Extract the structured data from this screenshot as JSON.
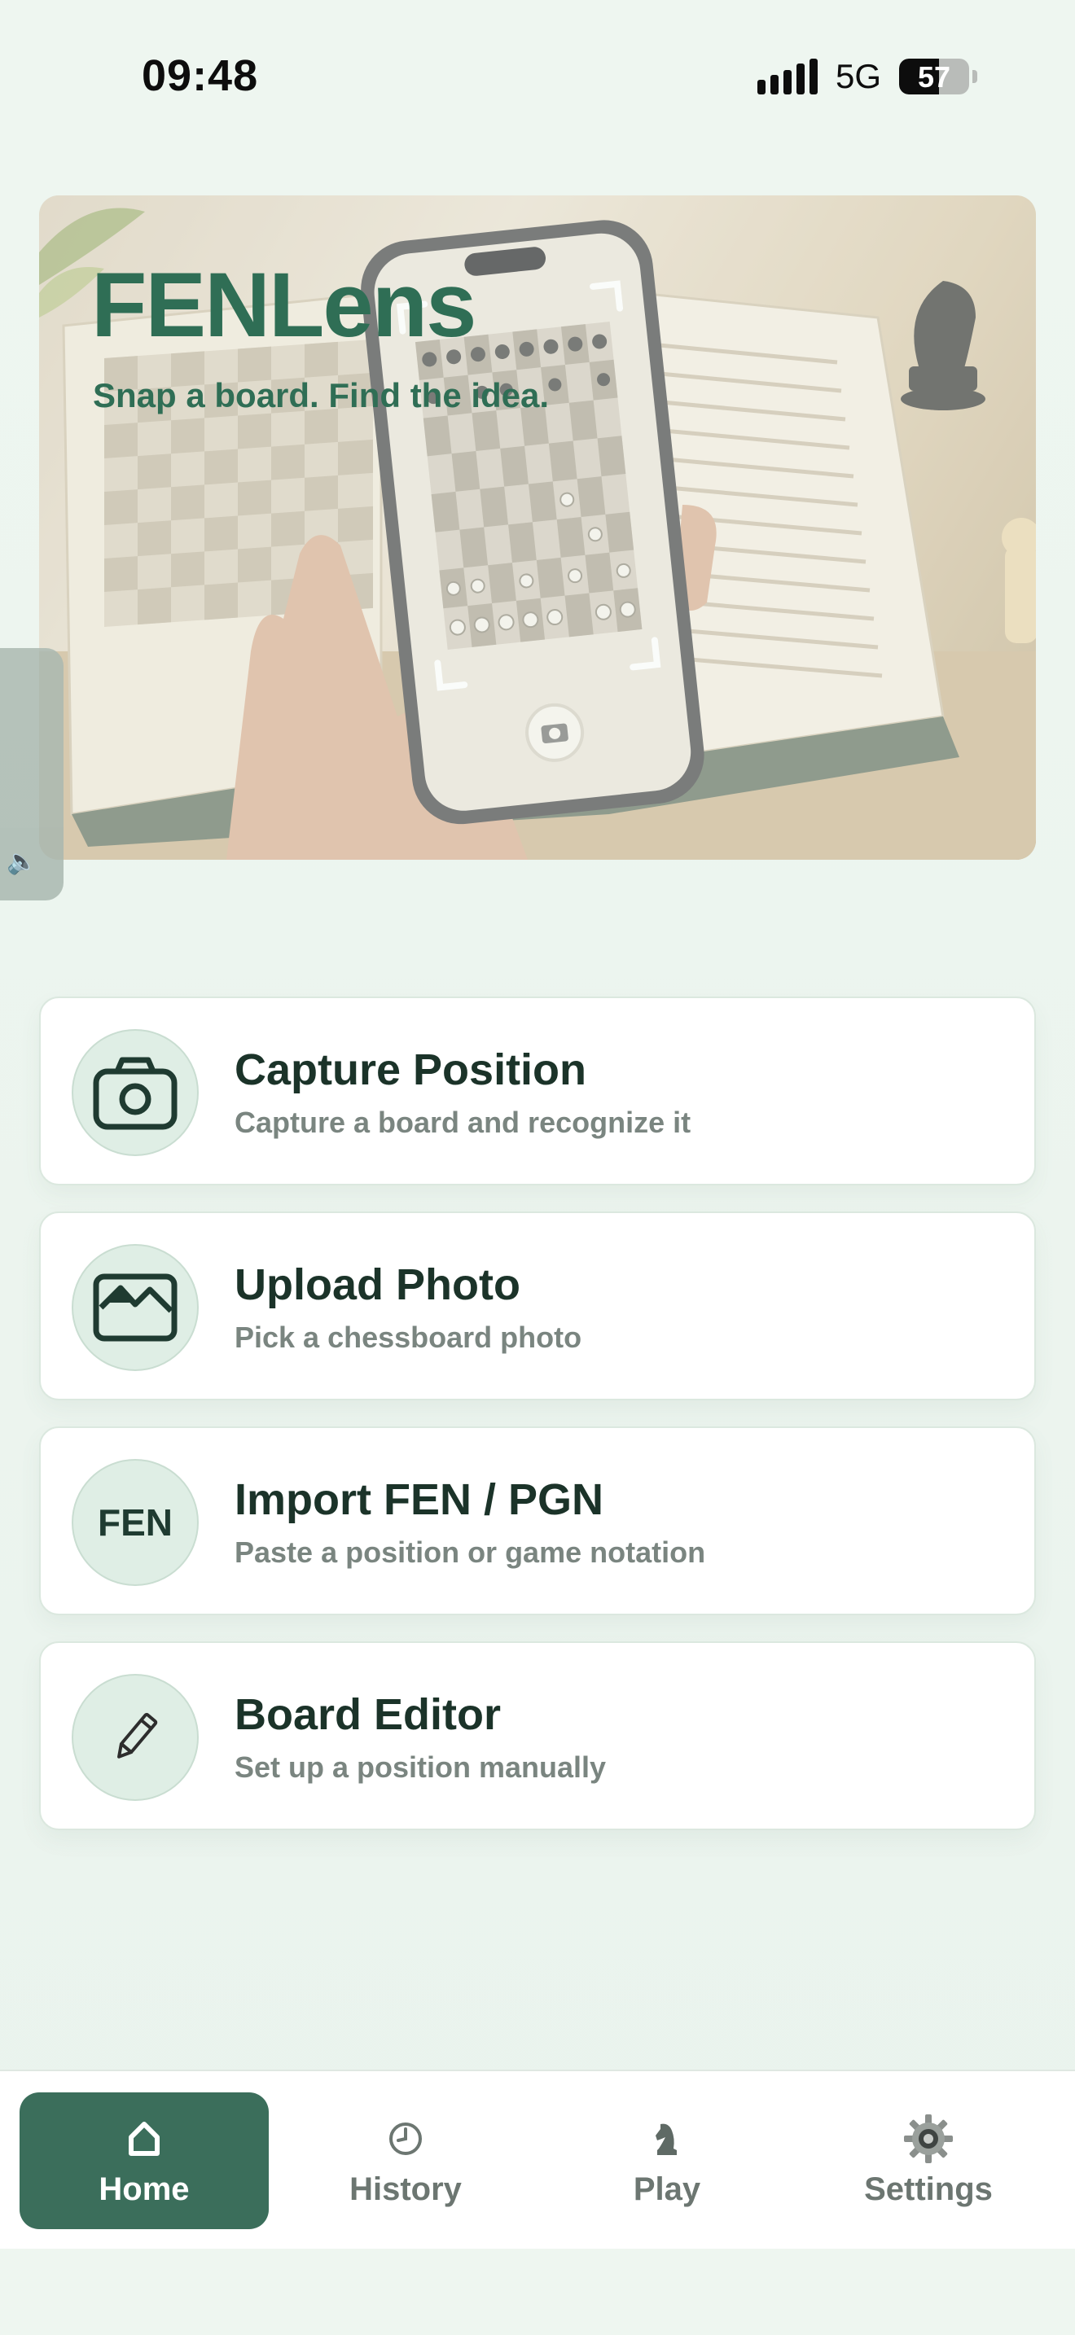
{
  "status_bar": {
    "time": "09:48",
    "network": "5G",
    "battery_percent": "57",
    "battery_level": 0.57
  },
  "hero": {
    "title": "FENLens",
    "tagline": "Snap a board. Find the idea."
  },
  "actions": [
    {
      "icon": "camera-icon",
      "title": "Capture Position",
      "subtitle": "Capture a board and recognize it"
    },
    {
      "icon": "photo-icon",
      "title": "Upload Photo",
      "subtitle": "Pick a chessboard photo"
    },
    {
      "icon": "fen-text-icon",
      "icon_text": "FEN",
      "title": "Import FEN / PGN",
      "subtitle": "Paste a position or game notation"
    },
    {
      "icon": "pencil-icon",
      "title": "Board Editor",
      "subtitle": "Set up a position manually"
    }
  ],
  "nav": {
    "active": "home",
    "items": [
      {
        "id": "home",
        "label": "Home",
        "icon": "home-icon"
      },
      {
        "id": "history",
        "label": "History",
        "icon": "clock-icon"
      },
      {
        "id": "play",
        "label": "Play",
        "icon": "knight-icon"
      },
      {
        "id": "settings",
        "label": "Settings",
        "icon": "gear-icon"
      }
    ]
  },
  "colors": {
    "accent": "#3b6e5b",
    "brand_text": "#2f6e55",
    "background": "#edf5ef",
    "card": "#ffffff"
  }
}
